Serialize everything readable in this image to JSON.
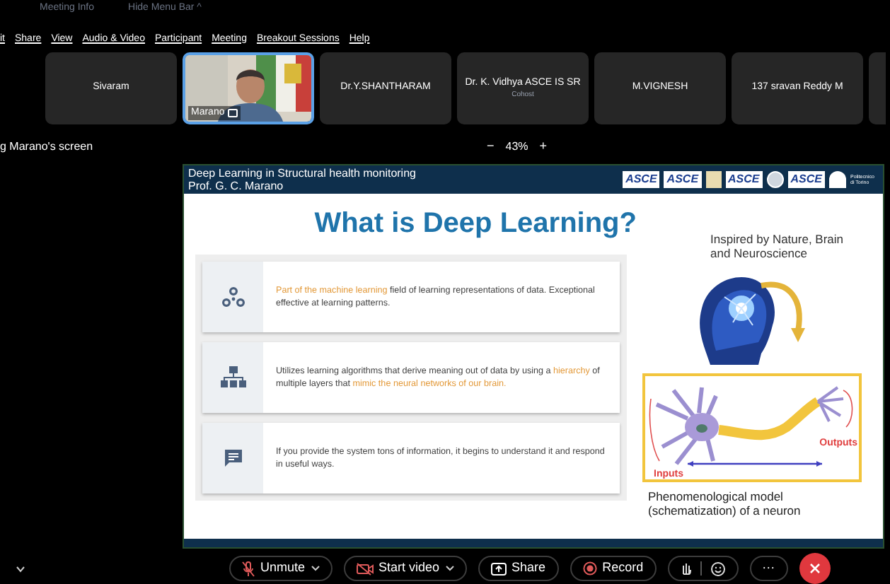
{
  "top_strip": {
    "items": [
      "Meeting Info",
      "Hide Menu Bar ^"
    ]
  },
  "menu_bar": [
    "it",
    "Share",
    "View",
    "Audio & Video",
    "Participant",
    "Meeting",
    "Breakout Sessions",
    "Help"
  ],
  "participants": [
    {
      "kind": "name",
      "name": "Sivaram",
      "speaking": false
    },
    {
      "kind": "video",
      "name": "Marano",
      "speaking": true
    },
    {
      "kind": "name",
      "name": "Dr.Y.SHANTHARAM",
      "speaking": false
    },
    {
      "kind": "name",
      "name": "Dr. K. Vidhya ASCE IS SR",
      "subtitle": "Cohost",
      "speaking": false
    },
    {
      "kind": "name",
      "name": "M.VIGNESH",
      "speaking": false
    },
    {
      "kind": "name",
      "name": "137 sravan Reddy M",
      "speaking": false
    }
  ],
  "share_bar": {
    "label": "g Marano's screen",
    "zoom_out": "−",
    "zoom": "43%",
    "zoom_in": "+"
  },
  "slide": {
    "header_lines": [
      "Deep Learning in Structural health monitoring",
      "Prof. G. C. Marano"
    ],
    "logos": [
      {
        "kind": "asce",
        "text": "ASCE"
      },
      {
        "kind": "asce",
        "text": "ASCE"
      },
      {
        "kind": "crest"
      },
      {
        "kind": "asce",
        "text": "ASCE"
      },
      {
        "kind": "seal"
      },
      {
        "kind": "asce",
        "text": "ASCE"
      },
      {
        "kind": "mountain"
      },
      {
        "kind": "text",
        "text": "Politecnico di Torino"
      }
    ],
    "title": "What is Deep Learning?",
    "cards": [
      {
        "segments": [
          {
            "text": "Part of the machine learning",
            "highlight": true
          },
          {
            "text": " field of learning representations of data. Exceptional effective at learning patterns.",
            "highlight": false
          }
        ]
      },
      {
        "segments": [
          {
            "text": "Utilizes learning algorithms that derive meaning out of data by using a ",
            "highlight": false
          },
          {
            "text": "hierarchy",
            "highlight": true
          },
          {
            "text": " of multiple layers that ",
            "highlight": false
          },
          {
            "text": "mimic the neural networks of our brain.",
            "highlight": true
          }
        ]
      },
      {
        "segments": [
          {
            "text": "If you provide the system tons of information, it begins to understand it and respond in useful ways.",
            "highlight": false
          }
        ]
      }
    ],
    "side_heading": "Inspired by Nature, Brain and Neuroscience",
    "neuron": {
      "inputs_label": "Inputs",
      "outputs_label": "Outputs"
    },
    "caption": "Phenomenological model (schematization) of a neuron"
  },
  "toolbar": [
    {
      "kind": "unmute",
      "label": "Unmute",
      "caret": true
    },
    {
      "kind": "video",
      "label": "Start video",
      "caret": true
    },
    {
      "kind": "share",
      "label": "Share",
      "caret": false
    },
    {
      "kind": "record",
      "label": "Record",
      "caret": false
    },
    {
      "kind": "reactions"
    },
    {
      "kind": "more",
      "label": "···"
    },
    {
      "kind": "leave"
    }
  ]
}
